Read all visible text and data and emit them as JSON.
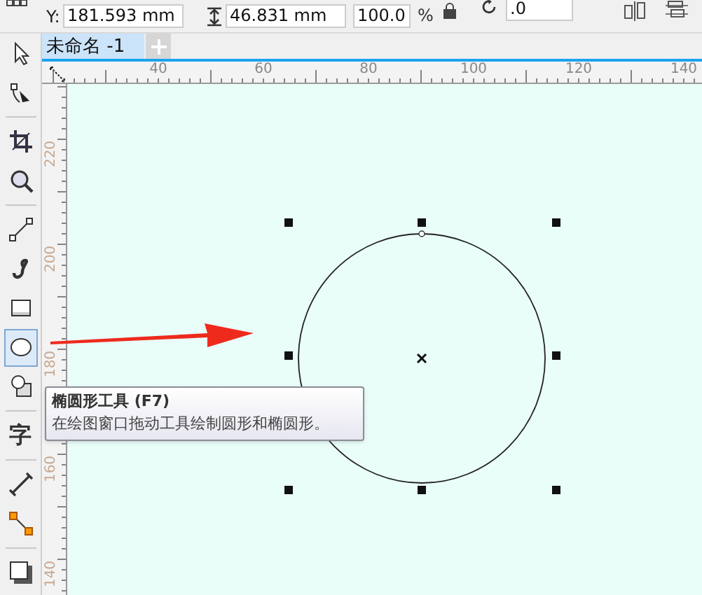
{
  "property_bar": {
    "y_label": "Y:",
    "y_value": "181.593 mm",
    "height_value": "46.831 mm",
    "scale_value": "100.0",
    "scale_unit": "%",
    "rotation_value": ".0"
  },
  "toolbox": [
    [
      {
        "kind": "pick",
        "selected": false
      },
      {
        "kind": "shape",
        "selected": false
      }
    ],
    [
      {
        "kind": "crop",
        "selected": false
      },
      {
        "kind": "zoom",
        "selected": false
      }
    ],
    [
      {
        "kind": "line",
        "selected": false
      },
      {
        "kind": "curve",
        "selected": false
      },
      {
        "kind": "rectangle",
        "selected": false
      },
      {
        "kind": "ellipse",
        "selected": true
      },
      {
        "kind": "polygon",
        "selected": false
      }
    ],
    [
      {
        "kind": "text",
        "label": "字",
        "selected": false
      }
    ],
    [
      {
        "kind": "dimension",
        "selected": false
      },
      {
        "kind": "connector",
        "selected": false
      }
    ],
    [
      {
        "kind": "shadow",
        "selected": false
      }
    ]
  ],
  "document_tabs": [
    {
      "label": "未命名 -1",
      "selected": true
    }
  ],
  "horizontal_ruler": [
    "40",
    "60",
    "80",
    "100",
    "120",
    "140"
  ],
  "vertical_ruler": [
    "220",
    "200",
    "180",
    "160",
    "140"
  ],
  "tooltip": {
    "title": "椭圆形工具 (F7)",
    "description": "在绘图窗口拖动工具绘制圆形和椭圆形。"
  }
}
